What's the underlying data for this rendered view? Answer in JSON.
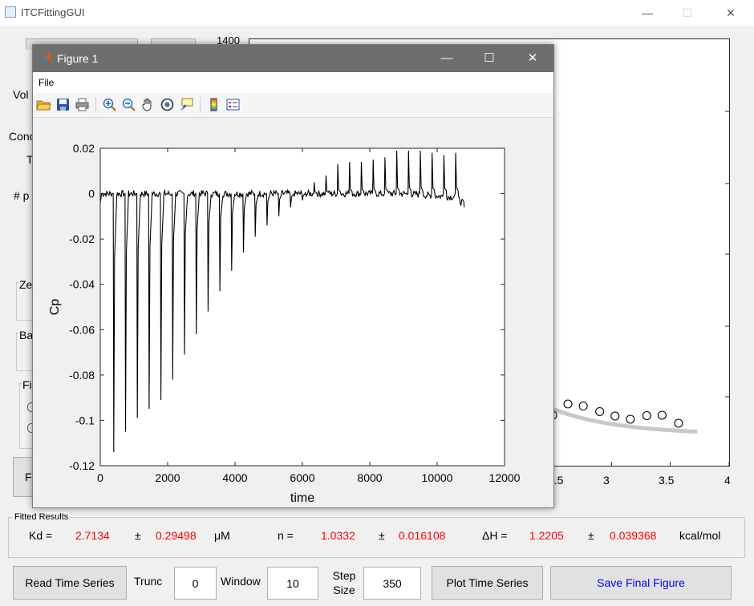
{
  "main_window": {
    "title": "ITCFittingGUI",
    "controls": {
      "minimize": "—",
      "maximize": "☐",
      "close": "✕"
    }
  },
  "background_labels": {
    "vol": "Vol",
    "conc": "Conc",
    "t": "T",
    "num_p": "# p",
    "ze": "Ze",
    "ba": "Ba",
    "fi": "Fi",
    "f_button": "F"
  },
  "background_axes": {
    "y_top_tick": "1400",
    "x_ticks": [
      "2.5",
      "3",
      "3.5",
      "4"
    ],
    "points_x": [
      2.5,
      2.63,
      2.76,
      2.9,
      3.03,
      3.16,
      3.3,
      3.43,
      3.57
    ],
    "points_y": [
      0.5,
      0.22,
      0.27,
      0.41,
      0.52,
      0.6,
      0.51,
      0.5,
      0.7
    ]
  },
  "figure_window": {
    "title": "Figure 1",
    "menu": [
      "File"
    ],
    "toolbar_icons": [
      "open-icon",
      "save-icon",
      "print-icon",
      "zoom-in-icon",
      "zoom-out-icon",
      "pan-icon",
      "rotate-icon",
      "data-cursor-icon",
      "colorbar-icon",
      "legend-icon"
    ],
    "controls": {
      "minimize": "—",
      "maximize": "☐",
      "close": "✕"
    }
  },
  "chart_data": {
    "type": "line",
    "xlabel": "time",
    "ylabel": "Cp",
    "xlim": [
      0,
      12000
    ],
    "ylim": [
      -0.12,
      0.02
    ],
    "x_ticks": [
      0,
      2000,
      4000,
      6000,
      8000,
      10000,
      12000
    ],
    "x_tick_labels": [
      "0",
      "2000",
      "4000",
      "6000",
      "8000",
      "10000",
      "12000"
    ],
    "y_ticks": [
      0.02,
      0,
      -0.02,
      -0.04,
      -0.06,
      -0.08,
      -0.1,
      -0.12
    ],
    "y_tick_labels": [
      "0.02",
      "0",
      "-0.02",
      "-0.04",
      "-0.06",
      "-0.08",
      "-0.1",
      "-0.12"
    ],
    "grid": false,
    "series": [
      {
        "color": "#000000",
        "baseline": 0.0,
        "end_x": 10800,
        "end_y": -0.006,
        "injection_times": [
          400,
          750,
          1100,
          1450,
          1800,
          2150,
          2500,
          2850,
          3200,
          3550,
          3900,
          4250,
          4600,
          4950,
          5300,
          5650,
          6000,
          6350,
          6700,
          7050,
          7400,
          7750,
          8100,
          8450,
          8800,
          9150,
          9500,
          9850,
          10200,
          10550
        ],
        "injection_peaks": [
          -0.114,
          -0.105,
          -0.099,
          -0.095,
          -0.091,
          -0.082,
          -0.071,
          -0.062,
          -0.052,
          -0.043,
          -0.034,
          -0.026,
          -0.019,
          -0.014,
          -0.01,
          -0.006,
          -0.003,
          0.005,
          0.008,
          0.013,
          0.014,
          0.014,
          0.015,
          0.016,
          0.019,
          0.019,
          0.019,
          0.018,
          0.017,
          0.018
        ]
      }
    ]
  },
  "fitted_results": {
    "title": "Fitted Results",
    "kd_label": "Kd =",
    "kd_value": "2.7134",
    "pm": "±",
    "kd_err": "0.29498",
    "kd_unit": "μM",
    "n_label": "n =",
    "n_value": "1.0332",
    "n_err": "0.016108",
    "dh_label": "ΔH =",
    "dh_value": "1.2205",
    "dh_err": "0.039368",
    "dh_unit": "kcal/mol"
  },
  "bottom_controls": {
    "read_button": "Read Time Series",
    "trunc_label": "Trunc",
    "trunc_value": "0",
    "window_label": "Window",
    "window_value": "10",
    "step_label_1": "Step",
    "step_label_2": "Size",
    "step_value": "350",
    "plot_button": "Plot Time Series",
    "save_button": "Save Final Figure",
    "save_color": "#0000ff"
  }
}
